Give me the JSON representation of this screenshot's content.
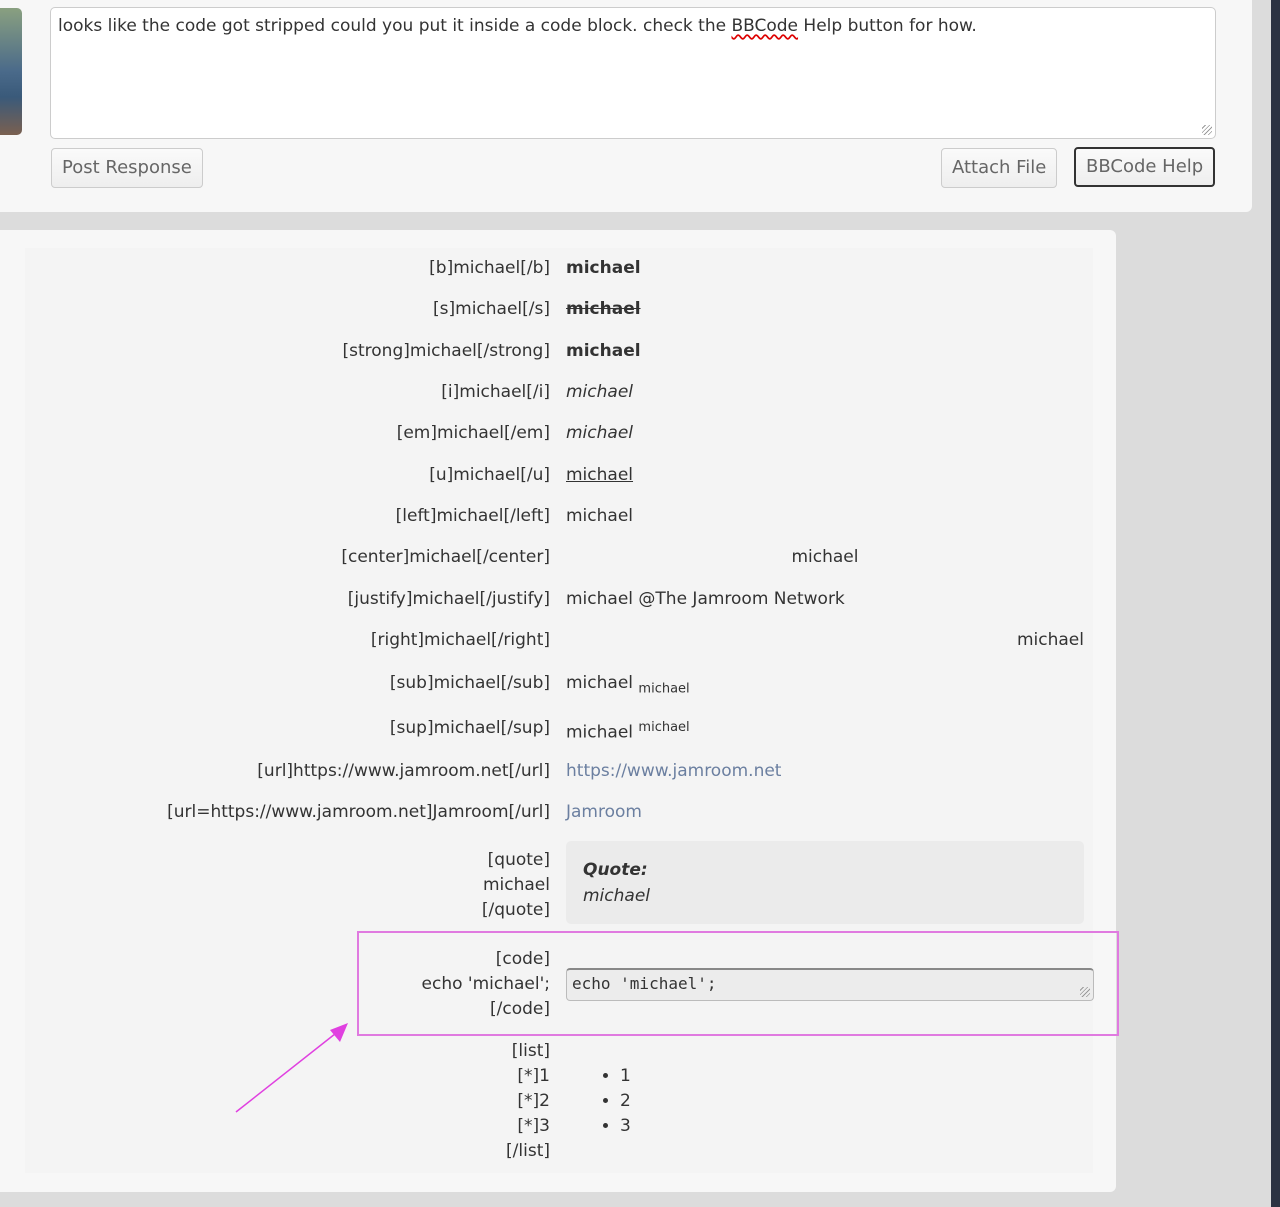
{
  "reply": {
    "text_before": "looks like the code got stripped could you put it inside a code block.  check the ",
    "text_misspelled": "BBCode",
    "text_after": " Help button for how."
  },
  "buttons": {
    "post": "Post Response",
    "attach": "Attach File",
    "bbcode_help": "BBCode Help"
  },
  "rows": [
    {
      "code": "[b]michael[/b]",
      "result": "michael",
      "style": "bold"
    },
    {
      "code": "[s]michael[/s]",
      "result": "michael",
      "style": "strike"
    },
    {
      "code": "[strong]michael[/strong]",
      "result": "michael",
      "style": "bold"
    },
    {
      "code": "[i]michael[/i]",
      "result": "michael",
      "style": "italic"
    },
    {
      "code": "[em]michael[/em]",
      "result": "michael",
      "style": "italic"
    },
    {
      "code": "[u]michael[/u]",
      "result": "michael",
      "style": "underline"
    },
    {
      "code": "[left]michael[/left]",
      "result": "michael",
      "style": "left"
    },
    {
      "code": "[center]michael[/center]",
      "result": "michael",
      "style": "center"
    },
    {
      "code": "[justify]michael[/justify]",
      "result": "michael @The Jamroom Network",
      "style": "justify"
    },
    {
      "code": "[right]michael[/right]",
      "result": "michael",
      "style": "right"
    },
    {
      "code": "[sub]michael[/sub]",
      "result": "michael",
      "result2": "michael",
      "style": "sub"
    },
    {
      "code": "[sup]michael[/sup]",
      "result": "michael",
      "result2": "michael",
      "style": "sup"
    },
    {
      "code": "[url]https://www.jamroom.net[/url]",
      "result": "https://www.jamroom.net",
      "style": "link"
    },
    {
      "code": "[url=https://www.jamroom.net]Jamroom[/url]",
      "result": "Jamroom",
      "style": "link"
    }
  ],
  "quote": {
    "lines": [
      "[quote]",
      "michael",
      "[/quote]"
    ],
    "label": "Quote:",
    "body": "michael"
  },
  "code": {
    "lines": [
      "[code]",
      "echo 'michael';",
      "[/code]"
    ],
    "output": "echo 'michael';"
  },
  "list": {
    "lines": [
      "[list]",
      "[*]1",
      "[*]2",
      "[*]3",
      "[/list]"
    ],
    "items": [
      "1",
      "2",
      "3"
    ]
  },
  "colors": {
    "highlight": "#e07ae0",
    "link": "#6b7fa0"
  }
}
